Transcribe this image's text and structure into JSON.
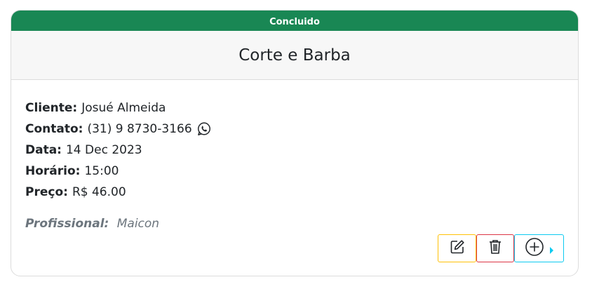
{
  "status": {
    "label": "Concluido",
    "color": "#198754"
  },
  "service": {
    "title": "Corte e Barba"
  },
  "details": {
    "client_label": "Cliente:",
    "client_value": "Josué Almeida",
    "contact_label": "Contato:",
    "contact_value": "(31) 9 8730-3166",
    "date_label": "Data:",
    "date_value": "14 Dec 2023",
    "time_label": "Horário:",
    "time_value": "15:00",
    "price_label": "Preço:",
    "price_value": "R$ 46.00"
  },
  "professional": {
    "label": "Profissional:",
    "value": "Maicon"
  },
  "actions": {
    "edit_icon": "edit-icon",
    "delete_icon": "trash-icon",
    "add_icon": "plus-circle-icon",
    "edit_color": "#ffc107",
    "delete_color": "#dc3545",
    "add_color": "#0dcaf0"
  },
  "icons": {
    "contact": "whatsapp-icon"
  }
}
